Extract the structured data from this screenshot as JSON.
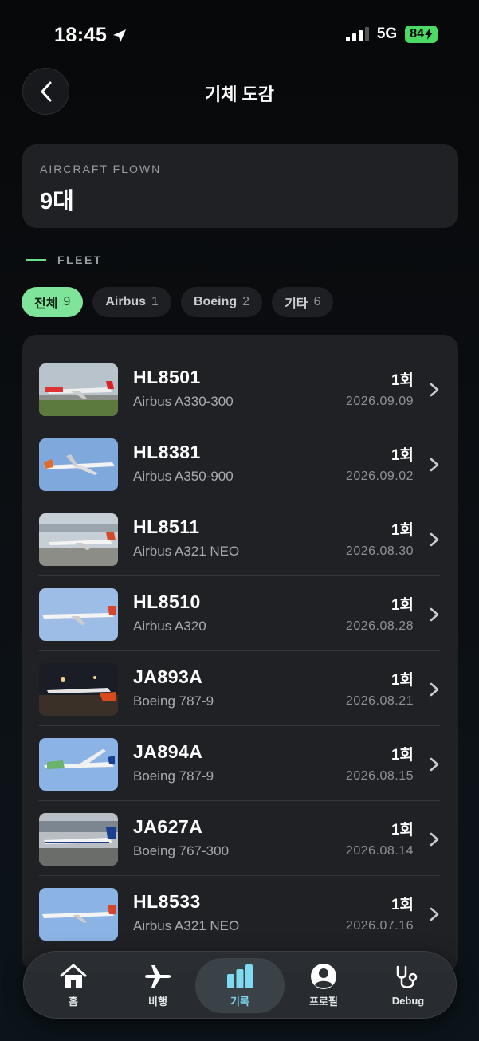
{
  "status_bar": {
    "time": "18:45",
    "network": "5G",
    "battery": "84"
  },
  "header": {
    "title": "기체 도감"
  },
  "summary": {
    "label": "AIRCRAFT FLOWN",
    "value": "9대"
  },
  "section": {
    "label": "FLEET"
  },
  "filters": [
    {
      "label": "전체",
      "count": "9"
    },
    {
      "label": "Airbus",
      "count": "1"
    },
    {
      "label": "Boeing",
      "count": "2"
    },
    {
      "label": "기타",
      "count": "6"
    }
  ],
  "aircraft": [
    {
      "reg": "HL8501",
      "model": "Airbus A330-300",
      "times": "1회",
      "date": "2026.09.09"
    },
    {
      "reg": "HL8381",
      "model": "Airbus A350-900",
      "times": "1회",
      "date": "2026.09.02"
    },
    {
      "reg": "HL8511",
      "model": "Airbus A321 NEO",
      "times": "1회",
      "date": "2026.08.30"
    },
    {
      "reg": "HL8510",
      "model": "Airbus A320",
      "times": "1회",
      "date": "2026.08.28"
    },
    {
      "reg": "JA893A",
      "model": "Boeing 787-9",
      "times": "1회",
      "date": "2026.08.21"
    },
    {
      "reg": "JA894A",
      "model": "Boeing 787-9",
      "times": "1회",
      "date": "2026.08.15"
    },
    {
      "reg": "JA627A",
      "model": "Boeing 767-300",
      "times": "1회",
      "date": "2026.08.14"
    },
    {
      "reg": "HL8533",
      "model": "Airbus A321 NEO",
      "times": "1회",
      "date": "2026.07.16"
    }
  ],
  "tabs": [
    {
      "label": "홈",
      "icon": "home-icon"
    },
    {
      "label": "비행",
      "icon": "airplane-icon"
    },
    {
      "label": "기록",
      "icon": "bar-chart-icon"
    },
    {
      "label": "프로필",
      "icon": "profile-icon"
    },
    {
      "label": "Debug",
      "icon": "stethoscope-icon"
    }
  ],
  "colors": {
    "accent_green": "#7ee49a",
    "accent_cyan": "#7fd9f0",
    "card": "#1f2124"
  }
}
